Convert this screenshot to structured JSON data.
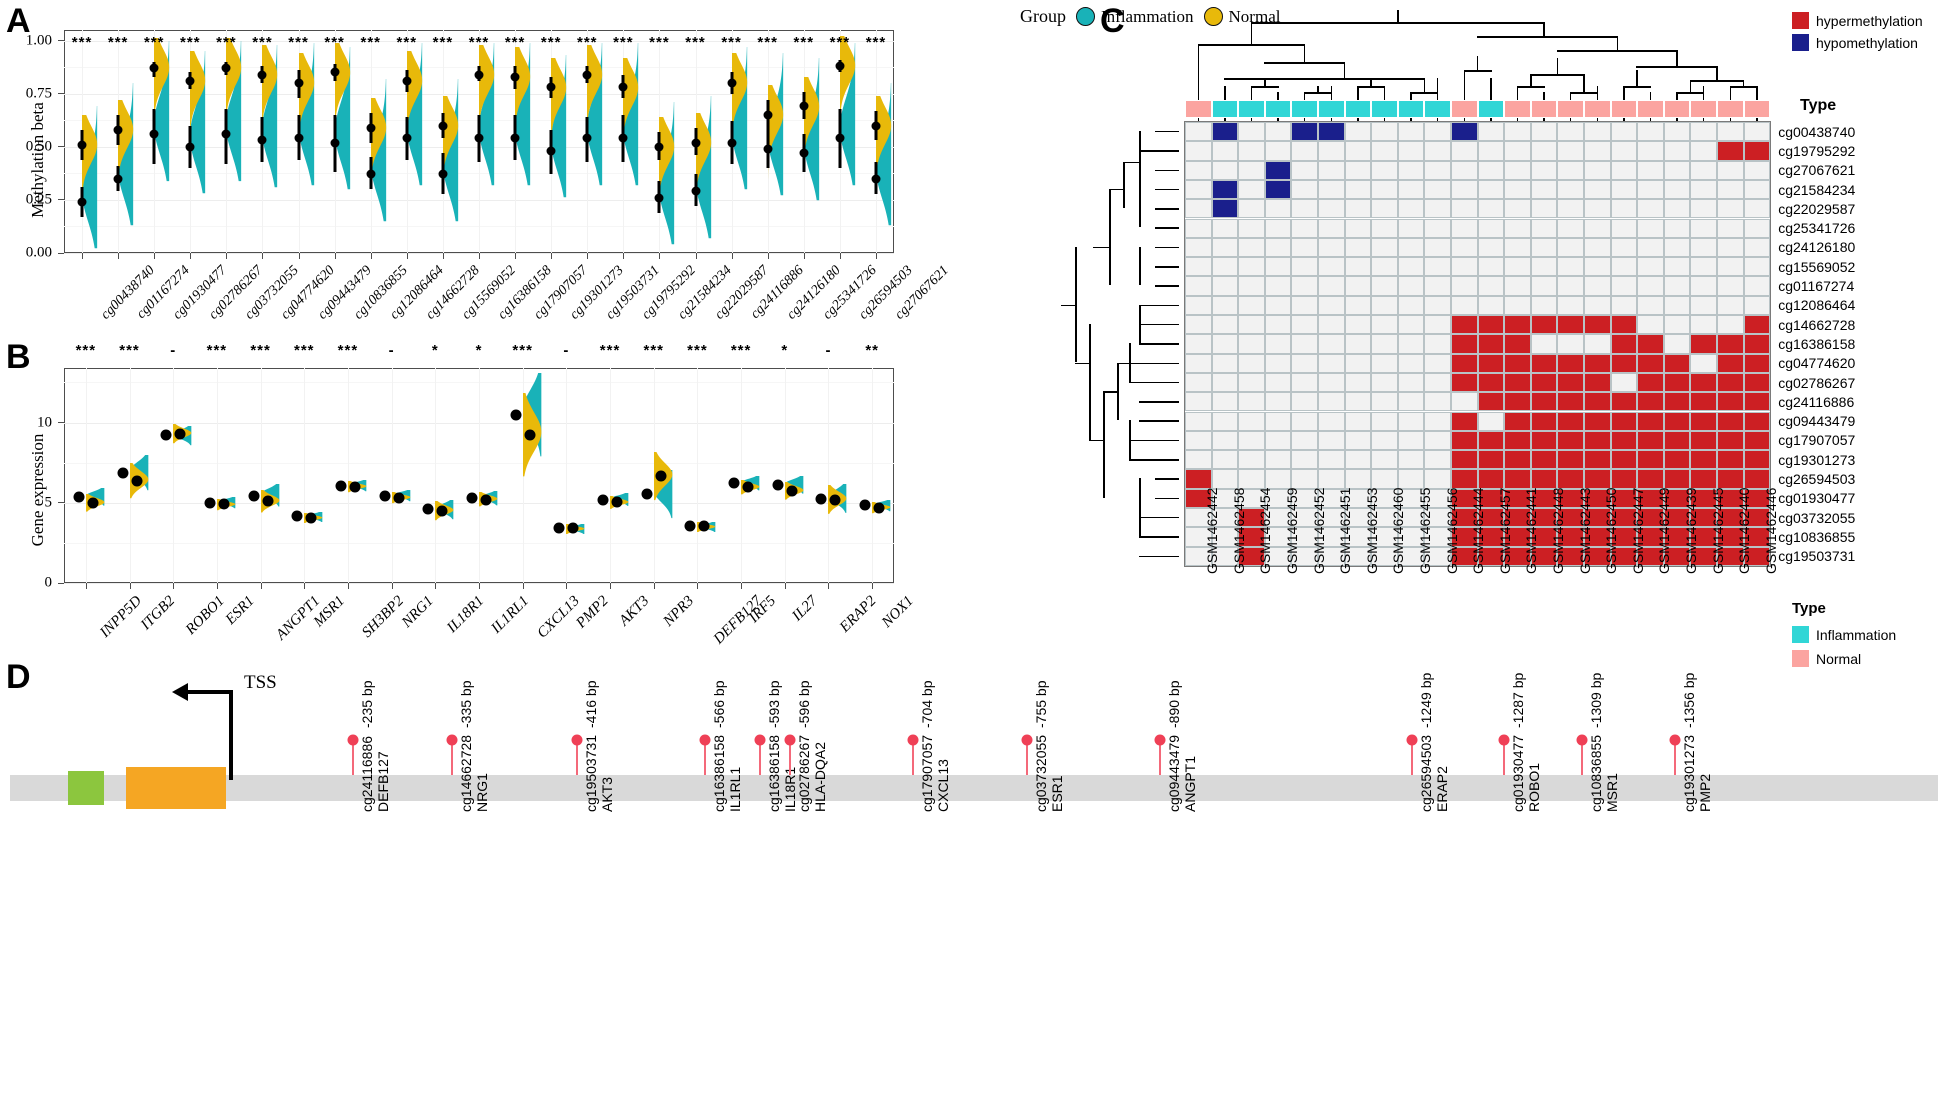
{
  "panels": {
    "a": {
      "letter": "A",
      "ylabel": "Methylation beta",
      "yticks": [
        "0.00",
        "0.25",
        "0.50",
        "0.75",
        "1.00"
      ],
      "ylim": [
        0,
        1.05
      ],
      "legend": {
        "title": "Group",
        "items": [
          {
            "label": "Inflammation",
            "color": "#19B2B8"
          },
          {
            "label": "Normal",
            "color": "#E8B90A"
          }
        ]
      }
    },
    "b": {
      "letter": "B",
      "ylabel": "Gene expression",
      "yticks": [
        "0",
        "5",
        "10"
      ],
      "ylim": [
        0,
        13.4
      ]
    },
    "c": {
      "letter": "C",
      "type_label": "Type",
      "legend_meth": {
        "items": [
          {
            "label": "hypermethylation",
            "color": "#CC1F23"
          },
          {
            "label": "hypomethylation",
            "color": "#1A1F8C"
          }
        ]
      },
      "legend_type": {
        "title": "Type",
        "items": [
          {
            "label": "Inflammation",
            "color": "#31D6D6"
          },
          {
            "label": "Normal",
            "color": "#FBA4A0"
          }
        ]
      }
    },
    "d": {
      "letter": "D",
      "tss_label": "TSS"
    }
  },
  "chart_data": [
    {
      "type": "violin",
      "panel": "A",
      "title": "",
      "ylabel": "Methylation beta",
      "xlabel": "",
      "ylim": [
        0,
        1.05
      ],
      "yticks": [
        0,
        0.25,
        0.5,
        0.75,
        1.0
      ],
      "grid": true,
      "legend_position": "top-right",
      "series": [
        {
          "name": "Inflammation",
          "color": "#19B2B8"
        },
        {
          "name": "Normal",
          "color": "#E8B90A"
        }
      ],
      "categories": [
        "cg00438740",
        "cg01167274",
        "cg01930477",
        "cg02786267",
        "cg03732055",
        "cg04774620",
        "cg09443479",
        "cg10836855",
        "cg12086464",
        "cg14662728",
        "cg15569052",
        "cg16386158",
        "cg17907057",
        "cg19301273",
        "cg19503731",
        "cg19795292",
        "cg21584234",
        "cg22029587",
        "cg24116886",
        "cg24126180",
        "cg25341726",
        "cg26594503",
        "cg27067621"
      ],
      "significance": [
        "***",
        "***",
        "***",
        "***",
        "***",
        "***",
        "***",
        "***",
        "***",
        "***",
        "***",
        "***",
        "***",
        "***",
        "***",
        "***",
        "***",
        "***",
        "***",
        "***",
        "***",
        "***",
        "***"
      ],
      "inflammation_mean": [
        0.24,
        0.35,
        0.56,
        0.5,
        0.56,
        0.53,
        0.54,
        0.52,
        0.37,
        0.54,
        0.37,
        0.54,
        0.54,
        0.48,
        0.54,
        0.54,
        0.26,
        0.29,
        0.52,
        0.49,
        0.47,
        0.54,
        0.35
      ],
      "inflammation_lo": [
        0.17,
        0.29,
        0.42,
        0.4,
        0.42,
        0.43,
        0.44,
        0.38,
        0.3,
        0.44,
        0.28,
        0.43,
        0.44,
        0.37,
        0.43,
        0.43,
        0.19,
        0.22,
        0.42,
        0.4,
        0.38,
        0.4,
        0.28
      ],
      "inflammation_hi": [
        0.31,
        0.41,
        0.68,
        0.6,
        0.68,
        0.64,
        0.65,
        0.65,
        0.45,
        0.64,
        0.47,
        0.65,
        0.65,
        0.58,
        0.64,
        0.65,
        0.34,
        0.37,
        0.62,
        0.58,
        0.56,
        0.68,
        0.43
      ],
      "normal_mean": [
        0.51,
        0.58,
        0.87,
        0.81,
        0.87,
        0.84,
        0.8,
        0.85,
        0.59,
        0.81,
        0.6,
        0.84,
        0.83,
        0.78,
        0.84,
        0.78,
        0.5,
        0.52,
        0.8,
        0.65,
        0.69,
        0.88,
        0.6
      ],
      "normal_lo": [
        0.44,
        0.51,
        0.83,
        0.77,
        0.84,
        0.8,
        0.73,
        0.81,
        0.52,
        0.76,
        0.54,
        0.81,
        0.77,
        0.73,
        0.8,
        0.73,
        0.44,
        0.46,
        0.75,
        0.58,
        0.63,
        0.85,
        0.53
      ],
      "normal_hi": [
        0.58,
        0.65,
        0.9,
        0.85,
        0.9,
        0.88,
        0.86,
        0.89,
        0.66,
        0.86,
        0.66,
        0.88,
        0.88,
        0.83,
        0.88,
        0.84,
        0.57,
        0.59,
        0.85,
        0.72,
        0.76,
        0.91,
        0.67
      ]
    },
    {
      "type": "violin",
      "panel": "B",
      "title": "",
      "ylabel": "Gene expression",
      "xlabel": "",
      "ylim": [
        0,
        13.4
      ],
      "yticks": [
        0,
        5,
        10
      ],
      "grid": true,
      "series": [
        {
          "name": "Inflammation",
          "color": "#19B2B8"
        },
        {
          "name": "Normal",
          "color": "#E8B90A"
        }
      ],
      "categories": [
        "INPP5D",
        "ITGB2",
        "ROBO1",
        "ESR1",
        "ANGPT1",
        "MSR1",
        "SH3BP2",
        "NRG1",
        "IL18R1",
        "IL1RL1",
        "CXCL13",
        "PMP2",
        "AKT3",
        "NPR3",
        "DEFB127",
        "IRF5",
        "IL27",
        "ERAP2",
        "NOX1"
      ],
      "significance": [
        "***",
        "***",
        "-",
        "***",
        "***",
        "***",
        "***",
        "-",
        "*",
        "*",
        "***",
        "-",
        "***",
        "***",
        "***",
        "***",
        "*",
        "-",
        "**"
      ],
      "inflammation_mean": [
        5.35,
        6.85,
        9.2,
        5.0,
        5.45,
        4.15,
        6.05,
        5.45,
        4.6,
        5.3,
        10.5,
        3.45,
        5.2,
        5.55,
        3.55,
        6.25,
        6.1,
        5.25,
        4.85
      ],
      "normal_mean": [
        5.0,
        6.35,
        9.3,
        4.9,
        5.1,
        4.05,
        6.0,
        5.3,
        4.5,
        5.2,
        9.25,
        3.45,
        5.05,
        6.65,
        3.55,
        6.0,
        5.75,
        5.2,
        4.7
      ]
    },
    {
      "type": "heatmap",
      "panel": "C",
      "title": "",
      "colors": {
        "hyper": "#CC1F23",
        "hypo": "#1A1F8C",
        "none": "#F2F2F2"
      },
      "column_labels": [
        "GSM1462442",
        "GSM1462458",
        "GSM1462454",
        "GSM1462459",
        "GSM1462452",
        "GSM1462451",
        "GSM1462453",
        "GSM1462460",
        "GSM1462455",
        "GSM1462456",
        "GSM1462444",
        "GSM1462457",
        "GSM1462441",
        "GSM1462448",
        "GSM1462443",
        "GSM1462450",
        "GSM1462447",
        "GSM1462449",
        "GSM1462439",
        "GSM1462445",
        "GSM1462440",
        "GSM1462446"
      ],
      "column_type": [
        "Normal",
        "Inflammation",
        "Inflammation",
        "Inflammation",
        "Inflammation",
        "Inflammation",
        "Inflammation",
        "Inflammation",
        "Inflammation",
        "Inflammation",
        "Normal",
        "Inflammation",
        "Normal",
        "Normal",
        "Normal",
        "Normal",
        "Normal",
        "Normal",
        "Normal",
        "Normal",
        "Normal",
        "Normal"
      ],
      "row_labels": [
        "cg00438740",
        "cg19795292",
        "cg27067621",
        "cg21584234",
        "cg22029587",
        "cg25341726",
        "cg24126180",
        "cg15569052",
        "cg01167274",
        "cg12086464",
        "cg14662728",
        "cg16386158",
        "cg04774620",
        "cg02786267",
        "cg24116886",
        "cg09443479",
        "cg17907057",
        "cg19301273",
        "cg26594503",
        "cg01930477",
        "cg03732055",
        "cg10836855",
        "cg19503731"
      ],
      "matrix": [
        [
          "none",
          "hypo",
          "none",
          "none",
          "hypo",
          "hypo",
          "none",
          "none",
          "none",
          "none",
          "hypo",
          "none",
          "none",
          "none",
          "none",
          "none",
          "none",
          "none",
          "none",
          "none",
          "none",
          "none"
        ],
        [
          "none",
          "none",
          "none",
          "none",
          "none",
          "none",
          "none",
          "none",
          "none",
          "none",
          "none",
          "none",
          "none",
          "none",
          "none",
          "none",
          "none",
          "none",
          "none",
          "none",
          "hyper",
          "hyper"
        ],
        [
          "none",
          "none",
          "none",
          "hypo",
          "none",
          "none",
          "none",
          "none",
          "none",
          "none",
          "none",
          "none",
          "none",
          "none",
          "none",
          "none",
          "none",
          "none",
          "none",
          "none",
          "none",
          "none"
        ],
        [
          "none",
          "hypo",
          "none",
          "hypo",
          "none",
          "none",
          "none",
          "none",
          "none",
          "none",
          "none",
          "none",
          "none",
          "none",
          "none",
          "none",
          "none",
          "none",
          "none",
          "none",
          "none",
          "none"
        ],
        [
          "none",
          "hypo",
          "none",
          "none",
          "none",
          "none",
          "none",
          "none",
          "none",
          "none",
          "none",
          "none",
          "none",
          "none",
          "none",
          "none",
          "none",
          "none",
          "none",
          "none",
          "none",
          "none"
        ],
        [
          "none",
          "none",
          "none",
          "none",
          "none",
          "none",
          "none",
          "none",
          "none",
          "none",
          "none",
          "none",
          "none",
          "none",
          "none",
          "none",
          "none",
          "none",
          "none",
          "none",
          "none",
          "none"
        ],
        [
          "none",
          "none",
          "none",
          "none",
          "none",
          "none",
          "none",
          "none",
          "none",
          "none",
          "none",
          "none",
          "none",
          "none",
          "none",
          "none",
          "none",
          "none",
          "none",
          "none",
          "none",
          "none"
        ],
        [
          "none",
          "none",
          "none",
          "none",
          "none",
          "none",
          "none",
          "none",
          "none",
          "none",
          "none",
          "none",
          "none",
          "none",
          "none",
          "none",
          "none",
          "none",
          "none",
          "none",
          "none",
          "none"
        ],
        [
          "none",
          "none",
          "none",
          "none",
          "none",
          "none",
          "none",
          "none",
          "none",
          "none",
          "none",
          "none",
          "none",
          "none",
          "none",
          "none",
          "none",
          "none",
          "none",
          "none",
          "none",
          "none"
        ],
        [
          "none",
          "none",
          "none",
          "none",
          "none",
          "none",
          "none",
          "none",
          "none",
          "none",
          "none",
          "none",
          "none",
          "none",
          "none",
          "none",
          "none",
          "none",
          "none",
          "none",
          "none",
          "none"
        ],
        [
          "none",
          "none",
          "none",
          "none",
          "none",
          "none",
          "none",
          "none",
          "none",
          "none",
          "hyper",
          "hyper",
          "hyper",
          "hyper",
          "hyper",
          "hyper",
          "hyper",
          "none",
          "none",
          "none",
          "none",
          "hyper"
        ],
        [
          "none",
          "none",
          "none",
          "none",
          "none",
          "none",
          "none",
          "none",
          "none",
          "none",
          "hyper",
          "hyper",
          "hyper",
          "none",
          "none",
          "none",
          "hyper",
          "hyper",
          "none",
          "hyper",
          "hyper",
          "hyper"
        ],
        [
          "none",
          "none",
          "none",
          "none",
          "none",
          "none",
          "none",
          "none",
          "none",
          "none",
          "hyper",
          "hyper",
          "hyper",
          "hyper",
          "hyper",
          "hyper",
          "hyper",
          "hyper",
          "hyper",
          "none",
          "hyper",
          "hyper"
        ],
        [
          "none",
          "none",
          "none",
          "none",
          "none",
          "none",
          "none",
          "none",
          "none",
          "none",
          "hyper",
          "hyper",
          "hyper",
          "hyper",
          "hyper",
          "hyper",
          "none",
          "hyper",
          "hyper",
          "hyper",
          "hyper",
          "hyper"
        ],
        [
          "none",
          "none",
          "none",
          "none",
          "none",
          "none",
          "none",
          "none",
          "none",
          "none",
          "none",
          "hyper",
          "hyper",
          "hyper",
          "hyper",
          "hyper",
          "hyper",
          "hyper",
          "hyper",
          "hyper",
          "hyper",
          "hyper"
        ],
        [
          "none",
          "none",
          "none",
          "none",
          "none",
          "none",
          "none",
          "none",
          "none",
          "none",
          "hyper",
          "none",
          "hyper",
          "hyper",
          "hyper",
          "hyper",
          "hyper",
          "hyper",
          "hyper",
          "hyper",
          "hyper",
          "hyper"
        ],
        [
          "none",
          "none",
          "none",
          "none",
          "none",
          "none",
          "none",
          "none",
          "none",
          "none",
          "hyper",
          "hyper",
          "hyper",
          "hyper",
          "hyper",
          "hyper",
          "hyper",
          "hyper",
          "hyper",
          "hyper",
          "hyper",
          "hyper"
        ],
        [
          "none",
          "none",
          "none",
          "none",
          "none",
          "none",
          "none",
          "none",
          "none",
          "none",
          "hyper",
          "hyper",
          "hyper",
          "hyper",
          "hyper",
          "hyper",
          "hyper",
          "hyper",
          "hyper",
          "hyper",
          "hyper",
          "hyper"
        ],
        [
          "hyper",
          "none",
          "none",
          "none",
          "none",
          "none",
          "none",
          "none",
          "none",
          "none",
          "hyper",
          "hyper",
          "hyper",
          "hyper",
          "hyper",
          "hyper",
          "hyper",
          "hyper",
          "hyper",
          "hyper",
          "hyper",
          "hyper"
        ],
        [
          "hyper",
          "none",
          "none",
          "none",
          "none",
          "none",
          "none",
          "none",
          "none",
          "none",
          "hyper",
          "hyper",
          "hyper",
          "hyper",
          "hyper",
          "hyper",
          "hyper",
          "hyper",
          "hyper",
          "hyper",
          "hyper",
          "hyper"
        ],
        [
          "none",
          "none",
          "hyper",
          "none",
          "none",
          "none",
          "none",
          "none",
          "none",
          "none",
          "hyper",
          "hyper",
          "hyper",
          "hyper",
          "hyper",
          "hyper",
          "hyper",
          "hyper",
          "hyper",
          "hyper",
          "hyper",
          "hyper"
        ],
        [
          "none",
          "none",
          "hyper",
          "none",
          "none",
          "none",
          "none",
          "none",
          "none",
          "none",
          "hyper",
          "hyper",
          "hyper",
          "hyper",
          "hyper",
          "hyper",
          "hyper",
          "hyper",
          "hyper",
          "hyper",
          "hyper",
          "hyper"
        ],
        [
          "none",
          "none",
          "hyper",
          "none",
          "none",
          "none",
          "none",
          "none",
          "none",
          "none",
          "hyper",
          "hyper",
          "hyper",
          "hyper",
          "hyper",
          "hyper",
          "hyper",
          "hyper",
          "hyper",
          "hyper",
          "hyper",
          "hyper"
        ]
      ]
    },
    {
      "type": "lollipop",
      "panel": "D",
      "title": "",
      "xlabel": "",
      "tss_label": "TSS",
      "markers": [
        {
          "bp": "-235 bp",
          "cpg": "cg24116886",
          "gene": "DEFB127"
        },
        {
          "bp": "-335 bp",
          "cpg": "cg14662728",
          "gene": "NRG1"
        },
        {
          "bp": "-416 bp",
          "cpg": "cg19503731",
          "gene": "AKT3"
        },
        {
          "bp": "-566 bp",
          "cpg": "cg16386158",
          "gene": "IL1RL1"
        },
        {
          "bp": "-593 bp",
          "cpg": "cg16386158",
          "gene": "IL18R1"
        },
        {
          "bp": "-596 bp",
          "cpg": "cg02786267",
          "gene": "HLA-DQA2"
        },
        {
          "bp": "-704 bp",
          "cpg": "cg17907057",
          "gene": "CXCL13"
        },
        {
          "bp": "-755 bp",
          "cpg": "cg03732055",
          "gene": "ESR1"
        },
        {
          "bp": "-890 bp",
          "cpg": "cg09443479",
          "gene": "ANGPT1"
        },
        {
          "bp": "-1249 bp",
          "cpg": "cg26594503",
          "gene": "ERAP2"
        },
        {
          "bp": "-1287 bp",
          "cpg": "cg01930477",
          "gene": "ROBO1"
        },
        {
          "bp": "-1309 bp",
          "cpg": "cg10836855",
          "gene": "MSR1"
        },
        {
          "bp": "-1356 bp",
          "cpg": "cg19301273",
          "gene": "PMP2"
        }
      ],
      "exons": [
        {
          "color": "#8CC63E"
        },
        {
          "color": "#F5A623"
        }
      ]
    }
  ]
}
